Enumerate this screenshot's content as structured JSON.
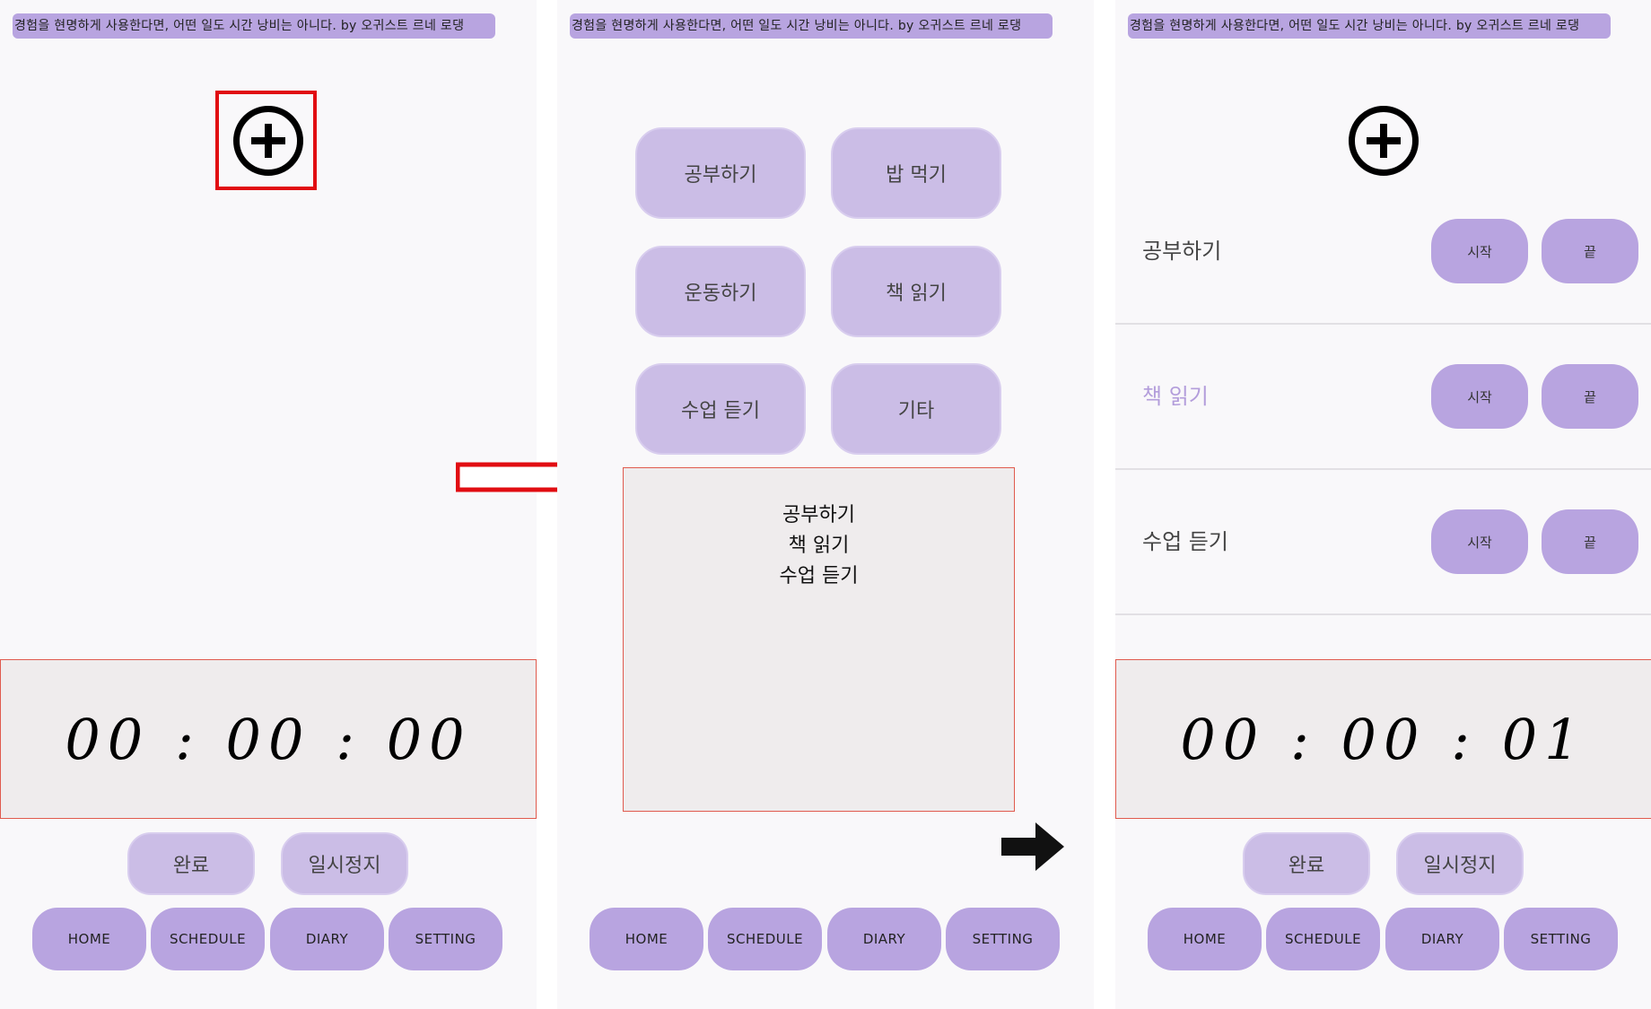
{
  "quote": "경험을 현명하게 사용한다면, 어떤 일도 시간 낭비는 아니다. by 오귀스트 르네 로댕",
  "timer_initial": "00 : 00 : 00",
  "timer_running": "00 : 00 : 01",
  "controls": {
    "done": "완료",
    "pause": "일시정지"
  },
  "nav": {
    "home": "HOME",
    "schedule": "SCHEDULE",
    "diary": "DIARY",
    "setting": "SETTING"
  },
  "activities": [
    "공부하기",
    "밥 먹기",
    "운동하기",
    "책 읽기",
    "수업 듣기",
    "기타"
  ],
  "selected": [
    "공부하기",
    "책 읽기",
    "수업 듣기"
  ],
  "activity_rows": [
    {
      "name": "공부하기",
      "start": "시작",
      "end": "끝"
    },
    {
      "name": "책 읽기",
      "start": "시작",
      "end": "끝"
    },
    {
      "name": "수업 듣기",
      "start": "시작",
      "end": "끝"
    }
  ],
  "colors": {
    "accent": "#b8a4e0",
    "button_light": "#cbbde6",
    "highlight": "#e10d12",
    "timer_border": "#e05a4e"
  }
}
